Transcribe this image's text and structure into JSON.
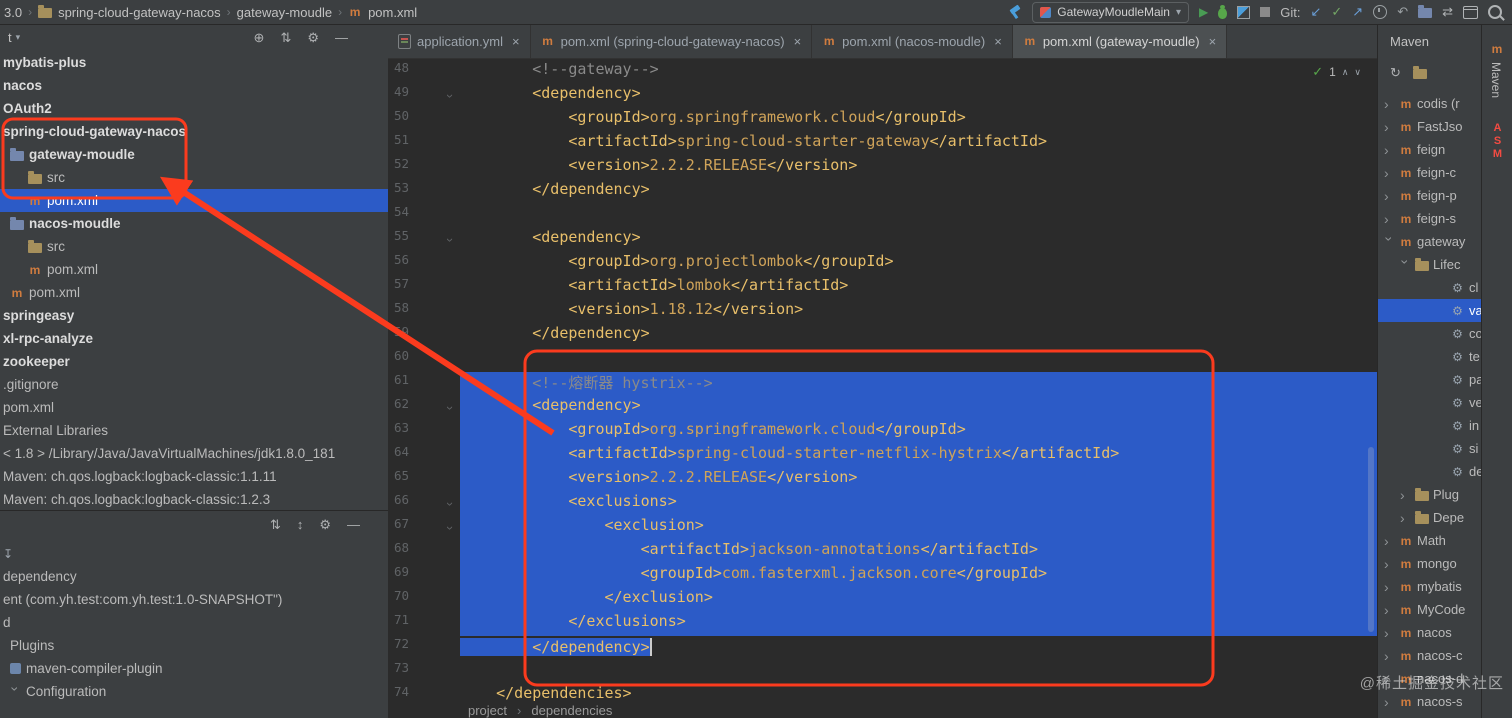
{
  "top_toolbar": {
    "breadcrumb": [
      {
        "label": "3.0",
        "icon": null
      },
      {
        "label": "spring-cloud-gateway-nacos",
        "icon": "folder"
      },
      {
        "label": "gateway-moudle",
        "icon": null
      },
      {
        "label": "pom.xml",
        "icon": "maven"
      }
    ],
    "run_config": "GatewayMoudleMain",
    "git_label": "Git:"
  },
  "project_panel": {
    "header_title": "t",
    "tree": [
      {
        "label": "mybatis-plus",
        "indent": 0,
        "bold": true
      },
      {
        "label": "nacos",
        "indent": 0,
        "bold": true
      },
      {
        "label": "OAuth2",
        "indent": 0,
        "bold": true
      },
      {
        "label": "spring-cloud-gateway-nacos",
        "indent": 0,
        "bold": true
      },
      {
        "label": "gateway-moudle",
        "indent": 1,
        "bold": true,
        "icon": "folderblue"
      },
      {
        "label": "src",
        "indent": 2,
        "icon": "folder"
      },
      {
        "label": "pom.xml",
        "indent": 2,
        "icon": "maven",
        "selected": true
      },
      {
        "label": "nacos-moudle",
        "indent": 1,
        "bold": true,
        "icon": "folderblue"
      },
      {
        "label": "src",
        "indent": 2,
        "icon": "folder"
      },
      {
        "label": "pom.xml",
        "indent": 2,
        "icon": "maven"
      },
      {
        "label": "pom.xml",
        "indent": 1,
        "icon": "maven"
      },
      {
        "label": "springeasy",
        "indent": 0,
        "bold": true
      },
      {
        "label": "xl-rpc-analyze",
        "indent": 0,
        "bold": true
      },
      {
        "label": "zookeeper",
        "indent": 0,
        "bold": true
      },
      {
        "label": ".gitignore",
        "indent": 0
      },
      {
        "label": "pom.xml",
        "indent": 0
      },
      {
        "label": "External Libraries",
        "indent": 0
      },
      {
        "label": "< 1.8 > /Library/Java/JavaVirtualMachines/jdk1.8.0_181",
        "indent": 0
      },
      {
        "label": "Maven: ch.qos.logback:logback-classic:1.1.11",
        "indent": 0
      },
      {
        "label": "Maven: ch.qos.logback:logback-classic:1.2.3",
        "indent": 0
      }
    ]
  },
  "structure_panel": {
    "items": [
      {
        "label": "",
        "icon": "sort",
        "indent": 0
      },
      {
        "label": "dependency",
        "indent": 0
      },
      {
        "label": "ent (com.yh.test:com.yh.test:1.0-SNAPSHOT\")",
        "indent": 0
      },
      {
        "label": "d",
        "indent": 0
      },
      {
        "label": "Plugins",
        "indent": 1
      },
      {
        "label": "maven-compiler-plugin",
        "indent": 1,
        "icon": "plugin"
      },
      {
        "label": "Configuration",
        "indent": 1,
        "chev": "v"
      }
    ]
  },
  "editor": {
    "tabs": [
      {
        "label": "application.yml",
        "icon": "yml",
        "active": false
      },
      {
        "label": "pom.xml (spring-cloud-gateway-nacos)",
        "icon": "maven",
        "active": false
      },
      {
        "label": "pom.xml (nacos-moudle)",
        "icon": "maven",
        "active": false
      },
      {
        "label": "pom.xml (gateway-moudle)",
        "icon": "maven",
        "active": true
      }
    ],
    "inspection": {
      "ok_count": "1"
    },
    "breadcrumb": [
      "project",
      "dependencies"
    ],
    "code": {
      "lines": [
        {
          "n": 48,
          "t": "        <!--gateway-->"
        },
        {
          "n": 49,
          "t": "        <dependency>",
          "fold": true
        },
        {
          "n": 50,
          "t": "            <groupId>org.springframework.cloud</groupId>"
        },
        {
          "n": 51,
          "t": "            <artifactId>spring-cloud-starter-gateway</artifactId>"
        },
        {
          "n": 52,
          "t": "            <version>2.2.2.RELEASE</version>"
        },
        {
          "n": 53,
          "t": "        </dependency>"
        },
        {
          "n": 54,
          "t": ""
        },
        {
          "n": 55,
          "t": "        <dependency>",
          "fold": true
        },
        {
          "n": 56,
          "t": "            <groupId>org.projectlombok</groupId>"
        },
        {
          "n": 57,
          "t": "            <artifactId>lombok</artifactId>"
        },
        {
          "n": 58,
          "t": "            <version>1.18.12</version>"
        },
        {
          "n": 59,
          "t": "        </dependency>"
        },
        {
          "n": 60,
          "t": ""
        },
        {
          "n": 61,
          "t": "        <!--熔断器 hystrix-->",
          "sel": "full"
        },
        {
          "n": 62,
          "t": "        <dependency>",
          "sel": "full",
          "fold": true
        },
        {
          "n": 63,
          "t": "            <groupId>org.springframework.cloud</groupId>",
          "sel": "full"
        },
        {
          "n": 64,
          "t": "            <artifactId>spring-cloud-starter-netflix-hystrix</artifactId>",
          "sel": "full"
        },
        {
          "n": 65,
          "t": "            <version>2.2.2.RELEASE</version>",
          "sel": "full"
        },
        {
          "n": 66,
          "t": "            <exclusions>",
          "sel": "full",
          "fold": true
        },
        {
          "n": 67,
          "t": "                <exclusion>",
          "sel": "full",
          "fold": true
        },
        {
          "n": 68,
          "t": "                    <artifactId>jackson-annotations</artifactId>",
          "sel": "full"
        },
        {
          "n": 69,
          "t": "                    <groupId>com.fasterxml.jackson.core</groupId>",
          "sel": "full"
        },
        {
          "n": 70,
          "t": "                </exclusion>",
          "sel": "full"
        },
        {
          "n": 71,
          "t": "            </exclusions>",
          "sel": "full"
        },
        {
          "n": 72,
          "t": "        </dependency>",
          "sel": "partial"
        },
        {
          "n": 73,
          "t": ""
        },
        {
          "n": 74,
          "t": "    </dependencies>"
        }
      ]
    }
  },
  "maven_panel": {
    "title": "Maven",
    "items": [
      {
        "label": "codis (r",
        "chev": ">",
        "icon": "maven",
        "indent": 0
      },
      {
        "label": "FastJso",
        "chev": ">",
        "icon": "maven",
        "indent": 0
      },
      {
        "label": "feign",
        "chev": ">",
        "icon": "maven",
        "indent": 0
      },
      {
        "label": "feign-c",
        "chev": ">",
        "icon": "maven",
        "indent": 0
      },
      {
        "label": "feign-p",
        "chev": ">",
        "icon": "maven",
        "indent": 0
      },
      {
        "label": "feign-s",
        "chev": ">",
        "icon": "maven",
        "indent": 0
      },
      {
        "label": "gateway",
        "chev": "v",
        "icon": "maven",
        "indent": 0
      },
      {
        "label": "Lifec",
        "chev": "v",
        "icon": "folder",
        "indent": 1
      },
      {
        "label": "cl",
        "icon": "gear",
        "indent": 2
      },
      {
        "label": "va",
        "icon": "gear",
        "indent": 2,
        "selected": true
      },
      {
        "label": "co",
        "icon": "gear",
        "indent": 2
      },
      {
        "label": "te",
        "icon": "gear",
        "indent": 2
      },
      {
        "label": "pa",
        "icon": "gear",
        "indent": 2
      },
      {
        "label": "ve",
        "icon": "gear",
        "indent": 2
      },
      {
        "label": "in",
        "icon": "gear",
        "indent": 2
      },
      {
        "label": "si",
        "icon": "gear",
        "indent": 2
      },
      {
        "label": "de",
        "icon": "gear",
        "indent": 2
      },
      {
        "label": "Plug",
        "chev": ">",
        "icon": "folder",
        "indent": 1
      },
      {
        "label": "Depe",
        "chev": ">",
        "icon": "folder",
        "indent": 1
      },
      {
        "label": "Math",
        "chev": ">",
        "icon": "maven",
        "indent": 0
      },
      {
        "label": "mongo",
        "chev": ">",
        "icon": "maven",
        "indent": 0
      },
      {
        "label": "mybatis",
        "chev": ">",
        "icon": "maven",
        "indent": 0
      },
      {
        "label": "MyCode",
        "chev": ">",
        "icon": "maven",
        "indent": 0
      },
      {
        "label": "nacos",
        "chev": ">",
        "icon": "maven",
        "indent": 0
      },
      {
        "label": "nacos-c",
        "chev": ">",
        "icon": "maven",
        "indent": 0
      },
      {
        "label": "nacos-d",
        "chev": ">",
        "icon": "maven",
        "indent": 0
      },
      {
        "label": "nacos-s",
        "chev": ">",
        "icon": "maven",
        "indent": 0
      }
    ]
  },
  "right_strip": {
    "tool_label": "Maven",
    "asm": "ASM"
  },
  "annotations": {
    "color": "#fb3b1e"
  },
  "watermark": "@稀土掘金技术社区"
}
